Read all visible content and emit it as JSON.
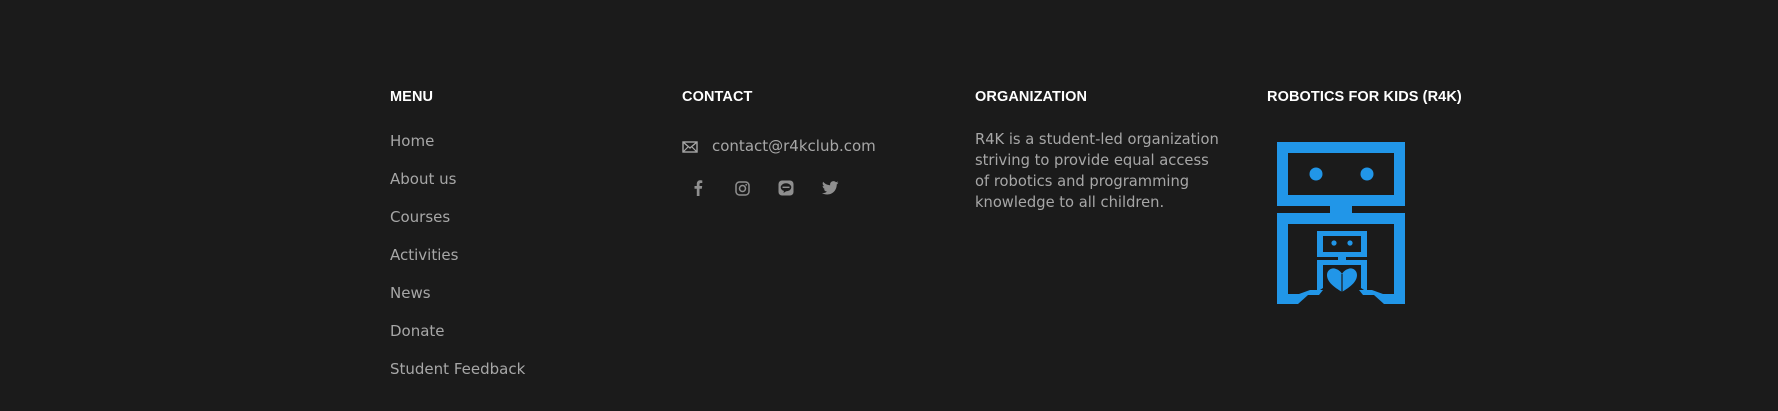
{
  "menu": {
    "title": "MENU",
    "items": [
      {
        "label": "Home"
      },
      {
        "label": "About us"
      },
      {
        "label": "Courses"
      },
      {
        "label": "Activities"
      },
      {
        "label": "News"
      },
      {
        "label": "Donate"
      },
      {
        "label": "Student Feedback"
      }
    ]
  },
  "contact": {
    "title": "CONTACT",
    "email": "contact@r4kclub.com",
    "email_icon": "mail-icon",
    "social": [
      {
        "icon": "facebook-icon"
      },
      {
        "icon": "instagram-icon"
      },
      {
        "icon": "line-icon"
      },
      {
        "icon": "twitter-icon"
      }
    ]
  },
  "organization": {
    "title": "ORGANIZATION",
    "description": "R4K is a student-led organization striving to provide equal access of robotics and programming knowledge to all children."
  },
  "brand": {
    "title": "ROBOTICS FOR KIDS (R4K)",
    "logo_icon": "r4k-robot-logo",
    "logo_color": "#2196e8"
  },
  "colors": {
    "background": "#1b1b1b",
    "heading": "#ffffff",
    "text": "#a7a7a7",
    "accent": "#2196e8"
  }
}
